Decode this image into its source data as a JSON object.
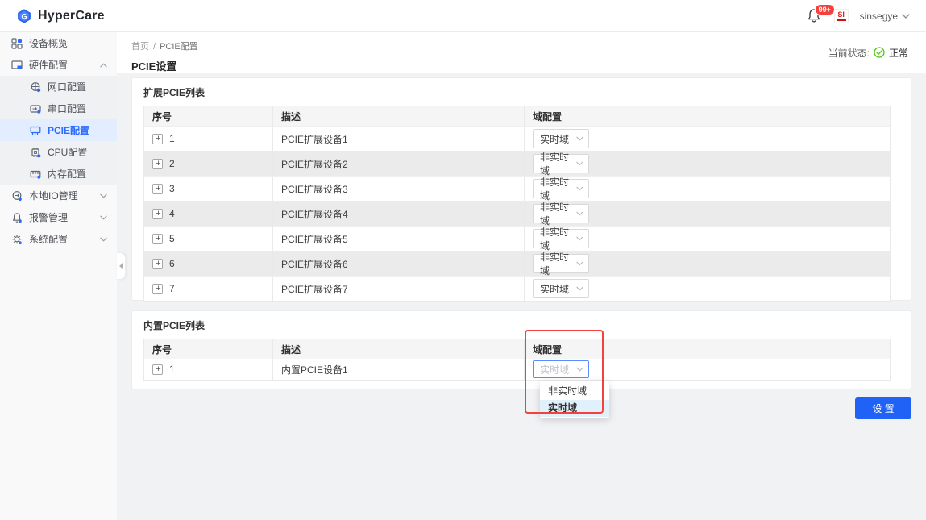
{
  "app": {
    "name": "HyperCare"
  },
  "header": {
    "notification_count": "99+",
    "avatar_text": "SI",
    "username": "sinsegye"
  },
  "sidebar": {
    "items": [
      {
        "label": "设备概览",
        "icon": "grid-icon"
      },
      {
        "label": "硬件配置",
        "icon": "hardware-icon",
        "state": "expanded",
        "children": [
          {
            "label": "网口配置",
            "icon": "network-port-icon"
          },
          {
            "label": "串口配置",
            "icon": "serial-port-icon"
          },
          {
            "label": "PCIE配置",
            "icon": "pcie-card-icon",
            "active": true
          },
          {
            "label": "CPU配置",
            "icon": "cpu-icon"
          },
          {
            "label": "内存配置",
            "icon": "memory-icon"
          }
        ]
      },
      {
        "label": "本地IO管理",
        "icon": "local-io-icon",
        "state": "collapsed"
      },
      {
        "label": "报警管理",
        "icon": "alarm-icon",
        "state": "collapsed"
      },
      {
        "label": "系统配置",
        "icon": "system-gear-icon",
        "state": "collapsed"
      }
    ]
  },
  "breadcrumb": {
    "home": "首页",
    "separator": "/",
    "current": "PCIE配置"
  },
  "page": {
    "title": "PCIE设置",
    "status_label": "当前状态:",
    "status_value": "正常"
  },
  "expansion_table": {
    "title": "扩展PCIE列表",
    "columns": [
      "序号",
      "描述",
      "域配置"
    ],
    "rows": [
      {
        "index": "1",
        "description": "PCIE扩展设备1",
        "domain": "实时域"
      },
      {
        "index": "2",
        "description": "PCIE扩展设备2",
        "domain": "非实时域"
      },
      {
        "index": "3",
        "description": "PCIE扩展设备3",
        "domain": "非实时域"
      },
      {
        "index": "4",
        "description": "PCIE扩展设备4",
        "domain": "非实时域"
      },
      {
        "index": "5",
        "description": "PCIE扩展设备5",
        "domain": "非实时域"
      },
      {
        "index": "6",
        "description": "PCIE扩展设备6",
        "domain": "非实时域"
      },
      {
        "index": "7",
        "description": "PCIE扩展设备7",
        "domain": "实时域"
      }
    ]
  },
  "builtin_table": {
    "title": "内置PCIE列表",
    "columns": [
      "序号",
      "描述",
      "域配置"
    ],
    "rows": [
      {
        "index": "1",
        "description": "内置PCIE设备1",
        "domain": "实时域",
        "dropdown_state": "open"
      }
    ],
    "dropdown_options": [
      {
        "label": "非实时域",
        "selected": false
      },
      {
        "label": "实时域",
        "selected": true
      }
    ]
  },
  "actions": {
    "submit": "设 置"
  },
  "colors": {
    "primary": "#1f62f5",
    "sidebar_active_bg": "#e2edff",
    "success": "#52c41a",
    "badge": "#f5413d",
    "annotation": "#f5413d",
    "row_stripe": "#ebebec"
  }
}
